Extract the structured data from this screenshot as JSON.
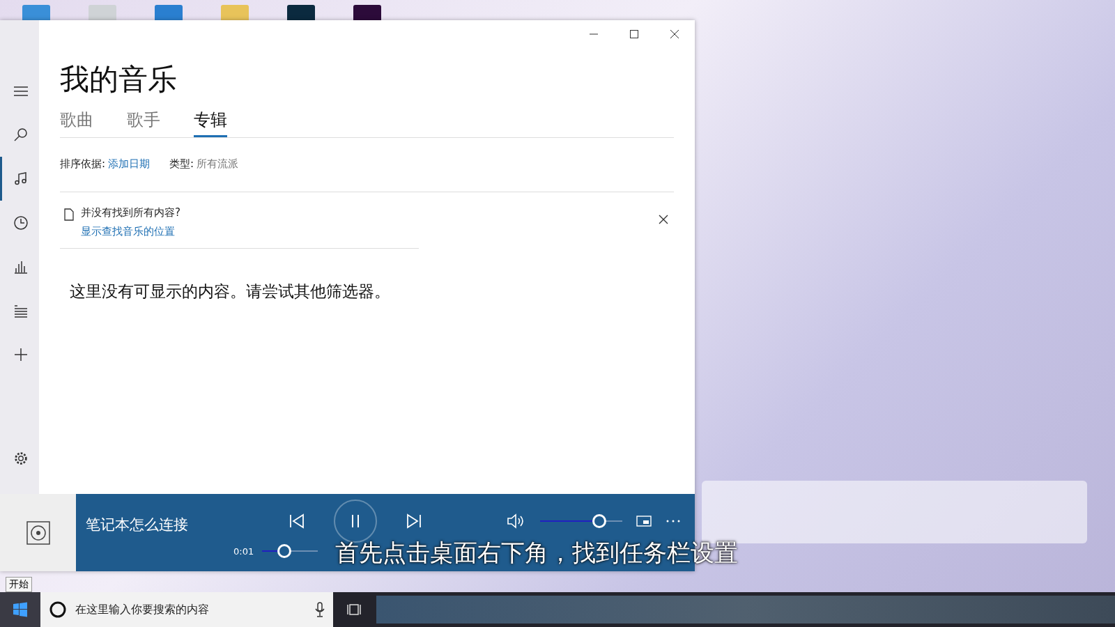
{
  "window": {
    "title": "我的音乐"
  },
  "tabs": [
    {
      "label": "歌曲",
      "selected": false
    },
    {
      "label": "歌手",
      "selected": false
    },
    {
      "label": "专辑",
      "selected": true
    }
  ],
  "sidebar": {
    "items": [
      {
        "kind": "songs",
        "selected": false
      },
      {
        "kind": "search",
        "selected": false
      },
      {
        "kind": "music",
        "selected": true
      },
      {
        "kind": "recent",
        "selected": false
      },
      {
        "kind": "chart",
        "selected": false
      },
      {
        "kind": "queue",
        "selected": false
      },
      {
        "kind": "add",
        "selected": false
      }
    ]
  },
  "filters": {
    "sort_label": "排序依据:",
    "sort_value": "添加日期",
    "genre_label": "类型:",
    "genre_value": "所有流派"
  },
  "notice": {
    "text": "并没有找到所有内容?",
    "link": "显示查找音乐的位置"
  },
  "empty_message": "这里没有可显示的内容。请尝试其他筛选器。",
  "player": {
    "track": "笔记本怎么连接",
    "playing": true,
    "volume": {
      "level": 0.72
    },
    "elapsed": "0:01",
    "progress": {
      "level": 0.4
    }
  },
  "subtitle": "首先点击桌面右下角，找到任务栏设置",
  "taskbar": {
    "start_tooltip": "开始",
    "search_placeholder": "在这里输入你要搜索的内容"
  }
}
